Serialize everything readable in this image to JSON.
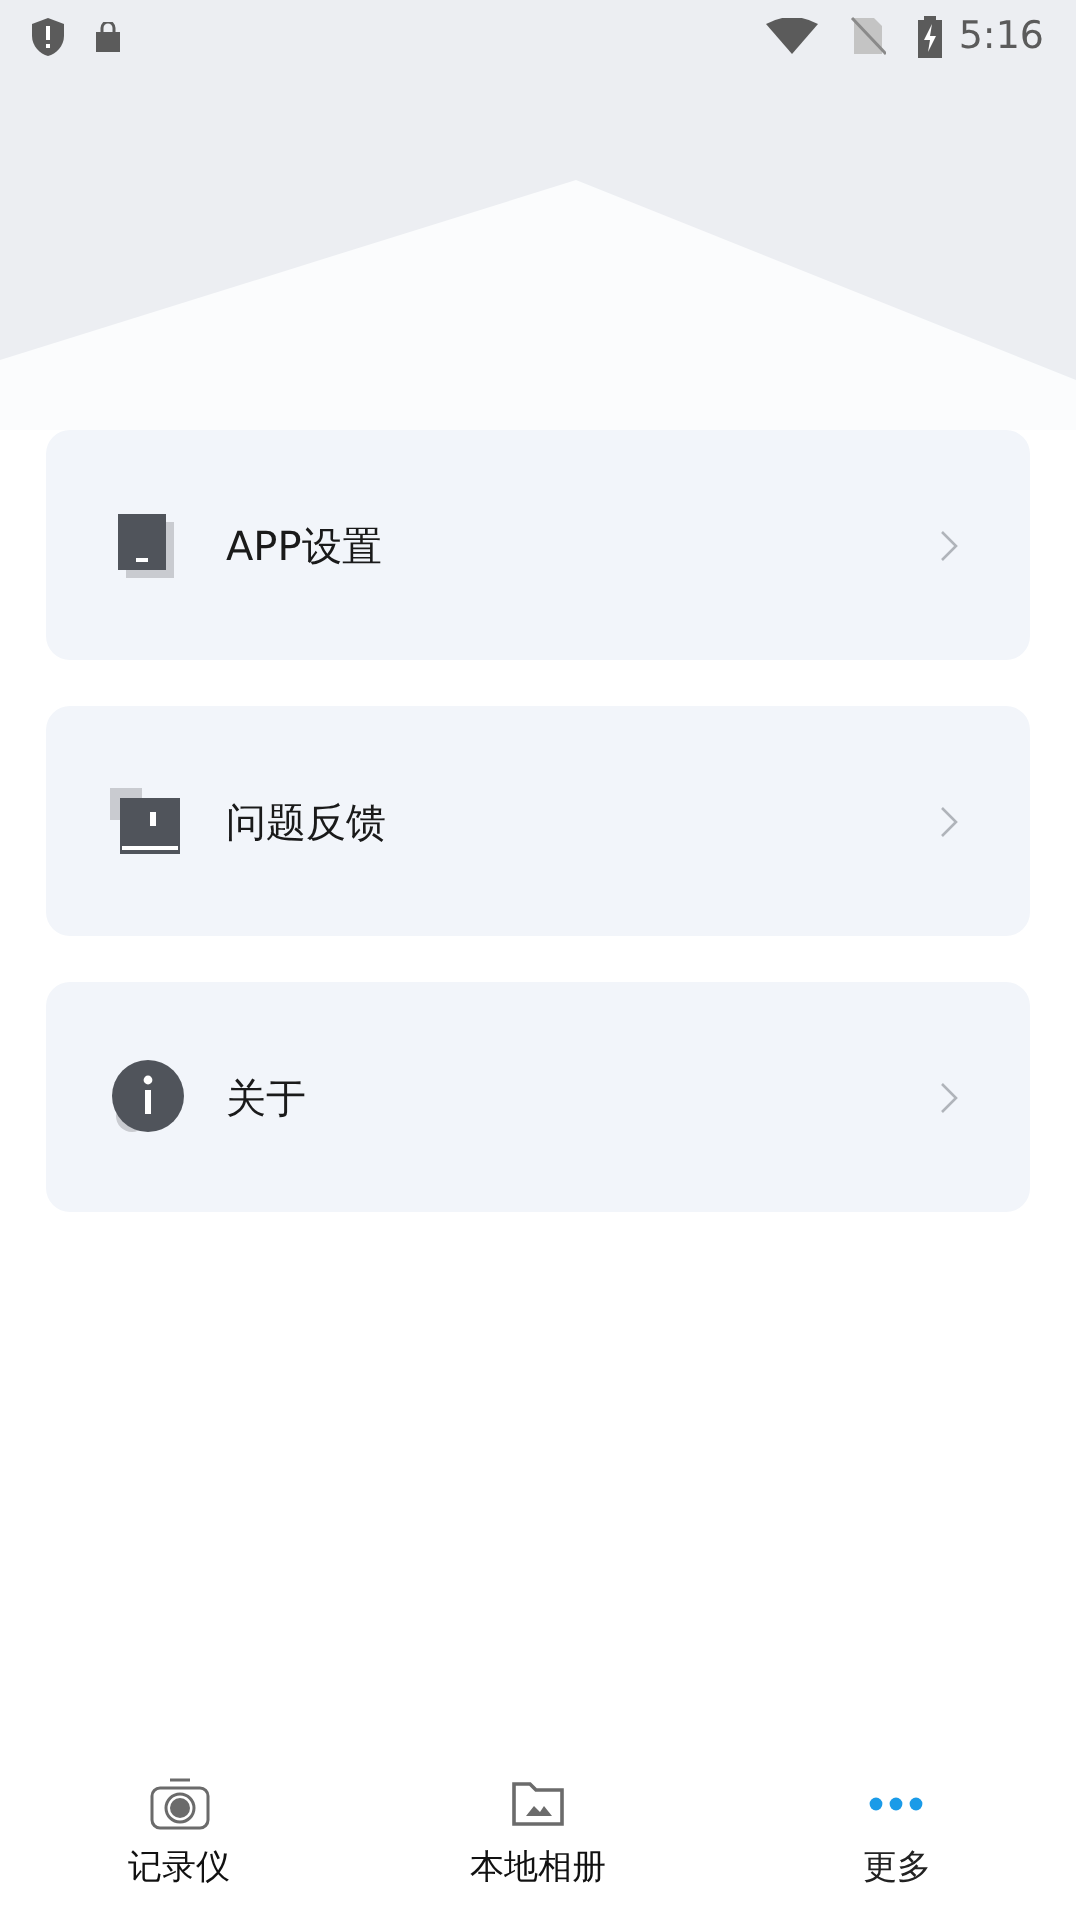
{
  "status_bar": {
    "time": "5:16"
  },
  "menu": [
    {
      "label": "APP设置",
      "kind": "settings"
    },
    {
      "label": "问题反馈",
      "kind": "feedback"
    },
    {
      "label": "关于",
      "kind": "about"
    }
  ],
  "bottom_nav": [
    {
      "label": "记录仪",
      "kind": "camera",
      "selected": false
    },
    {
      "label": "本地相册",
      "kind": "album",
      "selected": false
    },
    {
      "label": "更多",
      "kind": "more",
      "selected": true
    }
  ]
}
